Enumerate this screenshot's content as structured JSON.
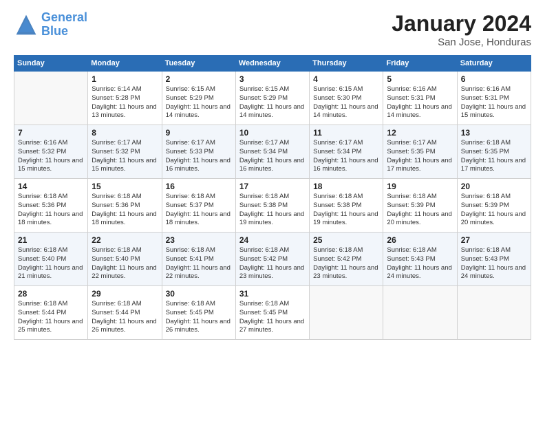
{
  "header": {
    "logo_line1": "General",
    "logo_line2": "Blue",
    "month_title": "January 2024",
    "location": "San Jose, Honduras"
  },
  "weekdays": [
    "Sunday",
    "Monday",
    "Tuesday",
    "Wednesday",
    "Thursday",
    "Friday",
    "Saturday"
  ],
  "weeks": [
    [
      {
        "day": "",
        "sunrise": "",
        "sunset": "",
        "daylight": ""
      },
      {
        "day": "1",
        "sunrise": "Sunrise: 6:14 AM",
        "sunset": "Sunset: 5:28 PM",
        "daylight": "Daylight: 11 hours and 13 minutes."
      },
      {
        "day": "2",
        "sunrise": "Sunrise: 6:15 AM",
        "sunset": "Sunset: 5:29 PM",
        "daylight": "Daylight: 11 hours and 14 minutes."
      },
      {
        "day": "3",
        "sunrise": "Sunrise: 6:15 AM",
        "sunset": "Sunset: 5:29 PM",
        "daylight": "Daylight: 11 hours and 14 minutes."
      },
      {
        "day": "4",
        "sunrise": "Sunrise: 6:15 AM",
        "sunset": "Sunset: 5:30 PM",
        "daylight": "Daylight: 11 hours and 14 minutes."
      },
      {
        "day": "5",
        "sunrise": "Sunrise: 6:16 AM",
        "sunset": "Sunset: 5:31 PM",
        "daylight": "Daylight: 11 hours and 14 minutes."
      },
      {
        "day": "6",
        "sunrise": "Sunrise: 6:16 AM",
        "sunset": "Sunset: 5:31 PM",
        "daylight": "Daylight: 11 hours and 15 minutes."
      }
    ],
    [
      {
        "day": "7",
        "sunrise": "Sunrise: 6:16 AM",
        "sunset": "Sunset: 5:32 PM",
        "daylight": "Daylight: 11 hours and 15 minutes."
      },
      {
        "day": "8",
        "sunrise": "Sunrise: 6:17 AM",
        "sunset": "Sunset: 5:32 PM",
        "daylight": "Daylight: 11 hours and 15 minutes."
      },
      {
        "day": "9",
        "sunrise": "Sunrise: 6:17 AM",
        "sunset": "Sunset: 5:33 PM",
        "daylight": "Daylight: 11 hours and 16 minutes."
      },
      {
        "day": "10",
        "sunrise": "Sunrise: 6:17 AM",
        "sunset": "Sunset: 5:34 PM",
        "daylight": "Daylight: 11 hours and 16 minutes."
      },
      {
        "day": "11",
        "sunrise": "Sunrise: 6:17 AM",
        "sunset": "Sunset: 5:34 PM",
        "daylight": "Daylight: 11 hours and 16 minutes."
      },
      {
        "day": "12",
        "sunrise": "Sunrise: 6:17 AM",
        "sunset": "Sunset: 5:35 PM",
        "daylight": "Daylight: 11 hours and 17 minutes."
      },
      {
        "day": "13",
        "sunrise": "Sunrise: 6:18 AM",
        "sunset": "Sunset: 5:35 PM",
        "daylight": "Daylight: 11 hours and 17 minutes."
      }
    ],
    [
      {
        "day": "14",
        "sunrise": "Sunrise: 6:18 AM",
        "sunset": "Sunset: 5:36 PM",
        "daylight": "Daylight: 11 hours and 18 minutes."
      },
      {
        "day": "15",
        "sunrise": "Sunrise: 6:18 AM",
        "sunset": "Sunset: 5:36 PM",
        "daylight": "Daylight: 11 hours and 18 minutes."
      },
      {
        "day": "16",
        "sunrise": "Sunrise: 6:18 AM",
        "sunset": "Sunset: 5:37 PM",
        "daylight": "Daylight: 11 hours and 18 minutes."
      },
      {
        "day": "17",
        "sunrise": "Sunrise: 6:18 AM",
        "sunset": "Sunset: 5:38 PM",
        "daylight": "Daylight: 11 hours and 19 minutes."
      },
      {
        "day": "18",
        "sunrise": "Sunrise: 6:18 AM",
        "sunset": "Sunset: 5:38 PM",
        "daylight": "Daylight: 11 hours and 19 minutes."
      },
      {
        "day": "19",
        "sunrise": "Sunrise: 6:18 AM",
        "sunset": "Sunset: 5:39 PM",
        "daylight": "Daylight: 11 hours and 20 minutes."
      },
      {
        "day": "20",
        "sunrise": "Sunrise: 6:18 AM",
        "sunset": "Sunset: 5:39 PM",
        "daylight": "Daylight: 11 hours and 20 minutes."
      }
    ],
    [
      {
        "day": "21",
        "sunrise": "Sunrise: 6:18 AM",
        "sunset": "Sunset: 5:40 PM",
        "daylight": "Daylight: 11 hours and 21 minutes."
      },
      {
        "day": "22",
        "sunrise": "Sunrise: 6:18 AM",
        "sunset": "Sunset: 5:40 PM",
        "daylight": "Daylight: 11 hours and 22 minutes."
      },
      {
        "day": "23",
        "sunrise": "Sunrise: 6:18 AM",
        "sunset": "Sunset: 5:41 PM",
        "daylight": "Daylight: 11 hours and 22 minutes."
      },
      {
        "day": "24",
        "sunrise": "Sunrise: 6:18 AM",
        "sunset": "Sunset: 5:42 PM",
        "daylight": "Daylight: 11 hours and 23 minutes."
      },
      {
        "day": "25",
        "sunrise": "Sunrise: 6:18 AM",
        "sunset": "Sunset: 5:42 PM",
        "daylight": "Daylight: 11 hours and 23 minutes."
      },
      {
        "day": "26",
        "sunrise": "Sunrise: 6:18 AM",
        "sunset": "Sunset: 5:43 PM",
        "daylight": "Daylight: 11 hours and 24 minutes."
      },
      {
        "day": "27",
        "sunrise": "Sunrise: 6:18 AM",
        "sunset": "Sunset: 5:43 PM",
        "daylight": "Daylight: 11 hours and 24 minutes."
      }
    ],
    [
      {
        "day": "28",
        "sunrise": "Sunrise: 6:18 AM",
        "sunset": "Sunset: 5:44 PM",
        "daylight": "Daylight: 11 hours and 25 minutes."
      },
      {
        "day": "29",
        "sunrise": "Sunrise: 6:18 AM",
        "sunset": "Sunset: 5:44 PM",
        "daylight": "Daylight: 11 hours and 26 minutes."
      },
      {
        "day": "30",
        "sunrise": "Sunrise: 6:18 AM",
        "sunset": "Sunset: 5:45 PM",
        "daylight": "Daylight: 11 hours and 26 minutes."
      },
      {
        "day": "31",
        "sunrise": "Sunrise: 6:18 AM",
        "sunset": "Sunset: 5:45 PM",
        "daylight": "Daylight: 11 hours and 27 minutes."
      },
      {
        "day": "",
        "sunrise": "",
        "sunset": "",
        "daylight": ""
      },
      {
        "day": "",
        "sunrise": "",
        "sunset": "",
        "daylight": ""
      },
      {
        "day": "",
        "sunrise": "",
        "sunset": "",
        "daylight": ""
      }
    ]
  ]
}
